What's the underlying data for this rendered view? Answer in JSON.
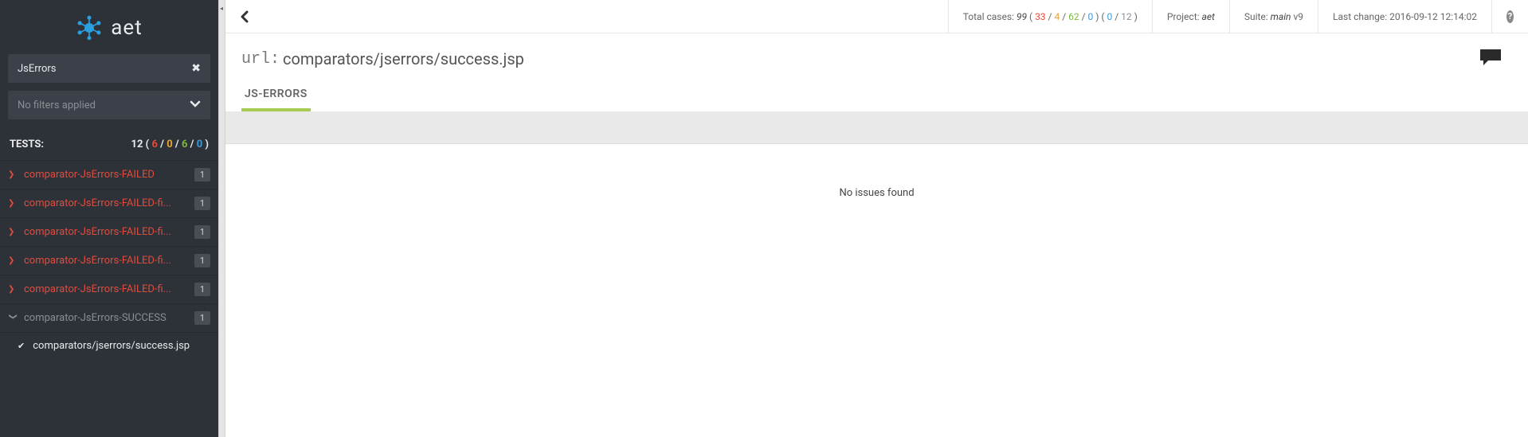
{
  "brand": {
    "name": "aet"
  },
  "sidebar": {
    "category": "JsErrors",
    "filters_label": "No filters applied",
    "tests_label": "TESTS:",
    "tests_total": "12",
    "counts": {
      "red": "6",
      "yellow": "0",
      "green": "6",
      "blue": "0"
    },
    "items": [
      {
        "name": "comparator-JsErrors-FAILED",
        "count": "1",
        "status": "failed"
      },
      {
        "name": "comparator-JsErrors-FAILED-fi...",
        "count": "1",
        "status": "failed"
      },
      {
        "name": "comparator-JsErrors-FAILED-fi...",
        "count": "1",
        "status": "failed"
      },
      {
        "name": "comparator-JsErrors-FAILED-fi...",
        "count": "1",
        "status": "failed"
      },
      {
        "name": "comparator-JsErrors-FAILED-fi...",
        "count": "1",
        "status": "failed"
      },
      {
        "name": "comparator-JsErrors-SUCCESS",
        "count": "1",
        "status": "success",
        "expanded": true,
        "children": [
          {
            "name": "comparators/jserrors/success.jsp"
          }
        ]
      }
    ]
  },
  "topbar": {
    "total_label": "Total cases:",
    "total_value": "99",
    "group1": {
      "red": "33",
      "yellow": "4",
      "green": "62",
      "blue": "0"
    },
    "group2": {
      "blue": "0",
      "gray": "12"
    },
    "project_label": "Project:",
    "project_value": "aet",
    "suite_label": "Suite:",
    "suite_value": "main",
    "suite_version": "v9",
    "lastchange_label": "Last change:",
    "lastchange_value": "2016-09-12 12:14:02"
  },
  "page": {
    "url_label": "url:",
    "url_value": "comparators/jserrors/success.jsp",
    "tab_label": "JS-ERRORS",
    "body_message": "No issues found"
  }
}
